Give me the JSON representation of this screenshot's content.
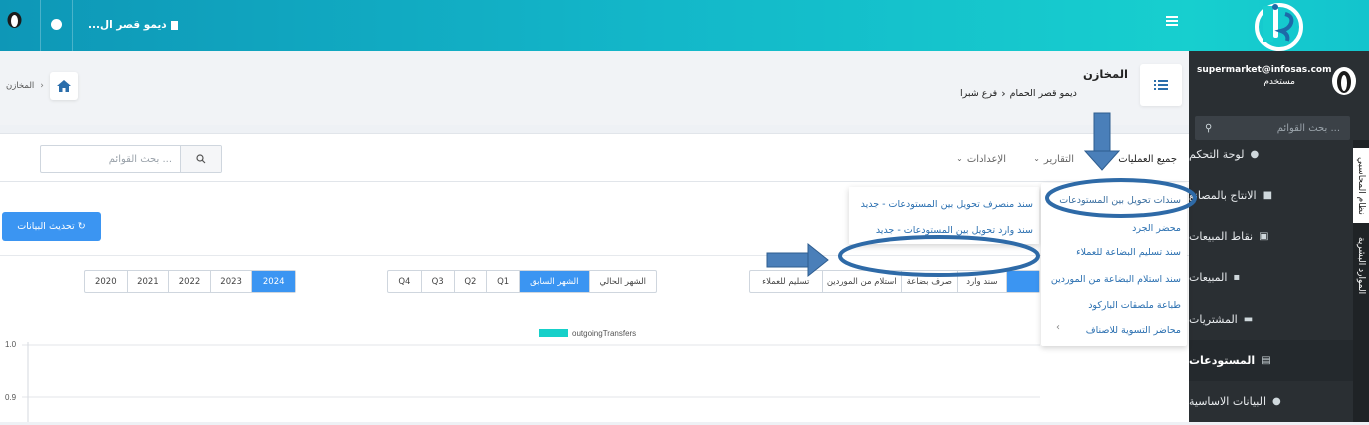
{
  "topbar": {
    "company": "ديمو قصر ال...",
    "menu_icon": "hamburger-icon",
    "globe_icon": "globe-icon",
    "avatar_icon": "user-avatar-icon"
  },
  "sidebar": {
    "user_email": "supermarket@infosas.com",
    "user_role": "مستخدم",
    "search_placeholder": "بحث القوائم ...",
    "items": [
      {
        "label": "لوحة التحكم",
        "icon": "info-icon"
      },
      {
        "label": "الانتاج بالمصانع",
        "icon": "factory-icon"
      },
      {
        "label": "نقاط المبيعات",
        "icon": "database-icon"
      },
      {
        "label": "المبيعات",
        "icon": "truck-icon"
      },
      {
        "label": "المشتريات",
        "icon": "money-icon"
      },
      {
        "label": "المستودعات",
        "icon": "warehouse-icon"
      },
      {
        "label": "البيانات الاساسية",
        "icon": "info-icon"
      }
    ],
    "vertical_tabs": [
      "نظام المحاسبي",
      "الموارد البشرية"
    ]
  },
  "page": {
    "title": "المخازن",
    "breadcrumb_company": "ديمو قصر الحمام",
    "breadcrumb_branch": "فرع شبرا",
    "home_crumb": "المخازن"
  },
  "menubar": {
    "all_operations": "جميع العمليات",
    "reports": "التقارير",
    "settings": "الإعدادات",
    "search_placeholder": "بحث القوائم ..."
  },
  "dropdown": {
    "items": [
      "سندات تحويل بين المستودعات",
      "محضر الجرد",
      "سند تسليم البضاعة للعملاء",
      "سند استلام البضاعة من الموردين",
      "طباعة ملصقات الباركود",
      "محاضر التسوية للاصناف"
    ]
  },
  "subdropdown": {
    "items": [
      "سند منصرف تحويل بين المستودعات - جديد",
      "سند وارد تحويل بين المستودعات - جديد"
    ]
  },
  "main": {
    "refresh_button": "تحديث البيانات ↻",
    "doc_types": [
      "سند وارد",
      "صرف بضاعة",
      "استلام من الموردين",
      "تسليم للعملاء"
    ],
    "periods": [
      "الشهر الحالي",
      "الشهر السابق",
      "Q1",
      "Q2",
      "Q3",
      "Q4"
    ],
    "selected_period": "الشهر السابق",
    "years": [
      "2024",
      "2023",
      "2022",
      "2021",
      "2020"
    ],
    "selected_year": "2024"
  },
  "chart_data": {
    "type": "line",
    "series": [
      {
        "name": "outgoingTransfers",
        "values": []
      }
    ],
    "y_ticks": [
      "1.0",
      "0.9"
    ],
    "ylim": [
      0.9,
      1.0
    ],
    "legend_placement": "top-center",
    "series_color": "#16d0c9"
  },
  "colors": {
    "accent": "#3b95f2",
    "topbar": "#13b7c9",
    "sidebar": "#2a2f33",
    "annotation": "#4a7fb9"
  }
}
